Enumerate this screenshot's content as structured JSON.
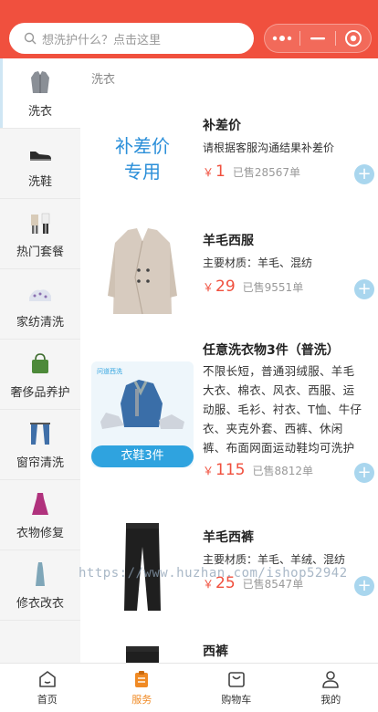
{
  "header": {
    "search_placeholder": "想洗护什么？点击这里",
    "capsule": {
      "more_icon": "more-dots-icon",
      "minimize_icon": "minimize-icon",
      "close_icon": "target-close-icon"
    },
    "accent_color": "#f0503e"
  },
  "sidebar": {
    "items": [
      {
        "label": "洗衣",
        "icon": "coat-icon",
        "active": true
      },
      {
        "label": "洗鞋",
        "icon": "shoe-icon"
      },
      {
        "label": "热门套餐",
        "icon": "outfit-icon"
      },
      {
        "label": "家纺清洗",
        "icon": "bedding-icon"
      },
      {
        "label": "奢侈品养护",
        "icon": "handbag-icon"
      },
      {
        "label": "窗帘清洗",
        "icon": "curtain-icon"
      },
      {
        "label": "衣物修复",
        "icon": "dress-icon"
      },
      {
        "label": "修衣改衣",
        "icon": "gown-icon"
      }
    ]
  },
  "content": {
    "section_title": "洗衣",
    "products": [
      {
        "name": "补差价",
        "desc": "请根据客服沟通结果补差价",
        "currency": "￥",
        "price": "1",
        "sold": "已售28567单",
        "image_text_line1": "补差价",
        "image_text_line2": "专用"
      },
      {
        "name": "羊毛西服",
        "desc": "主要材质：羊毛、混纺",
        "currency": "￥",
        "price": "29",
        "sold": "已售9551单"
      },
      {
        "name": "任意洗衣物3件（普洗）",
        "desc": "不限长短，普通羽绒服、羊毛大衣、棉衣、风衣、西服、运动服、毛衫、衬衣、T恤、牛仔衣、夹克外套、西裤、休闲裤、布面网面运动鞋均可洗护",
        "currency": "￥",
        "price": "115",
        "sold": "已售8812单",
        "badge": "衣鞋3件",
        "brand": "问道西洗"
      },
      {
        "name": "羊毛西裤",
        "desc": "主要材质：羊毛、羊绒、混纺",
        "currency": "￥",
        "price": "25",
        "sold": "已售8547单"
      },
      {
        "name": "西裤"
      }
    ],
    "add_symbol": "+"
  },
  "watermark": "https://www.huzhan.com/ishop52942",
  "tabbar": {
    "tabs": [
      {
        "label": "首页",
        "icon": "home-icon"
      },
      {
        "label": "服务",
        "icon": "clipboard-icon",
        "active": true
      },
      {
        "label": "购物车",
        "icon": "cart-bag-icon"
      },
      {
        "label": "我的",
        "icon": "user-icon"
      }
    ],
    "active_color": "#f08a24"
  }
}
